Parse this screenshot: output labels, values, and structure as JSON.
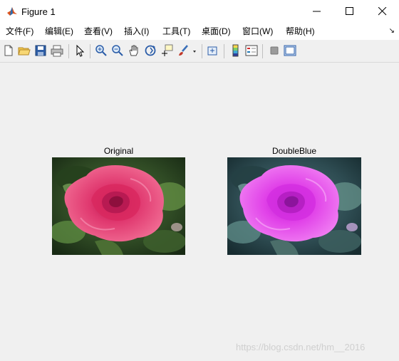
{
  "window": {
    "title": "Figure 1"
  },
  "menu": {
    "items": [
      "文件(F)",
      "编辑(E)",
      "查看(V)",
      "插入(I)",
      "工具(T)",
      "桌面(D)",
      "窗口(W)",
      "帮助(H)"
    ]
  },
  "toolbar": {
    "buttons": [
      "new-figure",
      "open-file",
      "save",
      "print",
      "edit-plot",
      "zoom-in",
      "zoom-out",
      "pan",
      "rotate-3d",
      "data-cursor",
      "brush",
      "link-plot",
      "insert-colorbar",
      "insert-legend",
      "hide-plot-tools",
      "show-plot-tools"
    ]
  },
  "axes": [
    {
      "title": "Original"
    },
    {
      "title": "DoubleBlue"
    }
  ],
  "watermark": "https://blog.csdn.net/hm__2016"
}
